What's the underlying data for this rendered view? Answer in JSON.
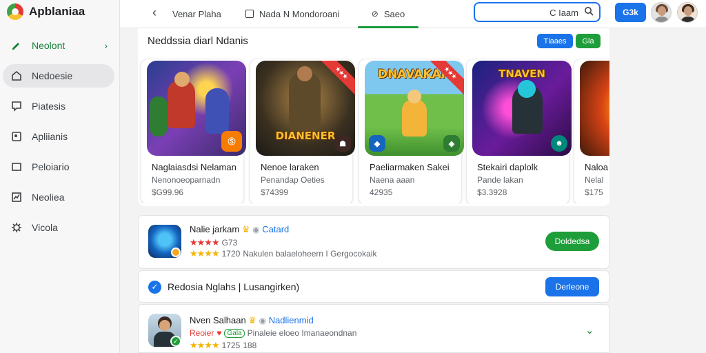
{
  "app": {
    "title": "Apblaniaa"
  },
  "sidebar": {
    "items": [
      {
        "label": "Neolont",
        "icon": "edit-pencil-icon"
      },
      {
        "label": "Nedoesie",
        "icon": "home-icon"
      },
      {
        "label": "Piatesis",
        "icon": "message-icon"
      },
      {
        "label": "Apliianis",
        "icon": "apps-icon"
      },
      {
        "label": "Peloiario",
        "icon": "tv-icon"
      },
      {
        "label": "Neoliea",
        "icon": "chart-icon"
      },
      {
        "label": "Vicola",
        "icon": "settings-icon"
      }
    ]
  },
  "topbar": {
    "tabs": [
      {
        "label": "Venar Plaha"
      },
      {
        "label": "Nada N Mondoroani"
      },
      {
        "label": "Saeo"
      }
    ],
    "search": {
      "value": "C Iaam",
      "placeholder": ""
    },
    "button_label": "G3k"
  },
  "section": {
    "title": "Neddssia diarl Ndanis",
    "pill_blue": "Tlaaes",
    "pill_green": "Gla"
  },
  "cards": [
    {
      "name": "Naglaiasdsi Nelaman",
      "developer": "Nenonoeoparnadn",
      "price": "$G99.96"
    },
    {
      "name": "Nenoe laraken",
      "developer": "Penandap Oeties",
      "price": "$74399",
      "art_title": "DIANENER"
    },
    {
      "name": "Paeliarmaken Sakei",
      "developer": "Naena aaan",
      "price": "42935",
      "art_title": "DNAVAKAN"
    },
    {
      "name": "Stekairi daplolk",
      "developer": "Pande lakan",
      "price": "$3.3928",
      "art_title": "TNAVEN"
    },
    {
      "name": "Naloa",
      "developer": "Nelal",
      "price": "$175"
    }
  ],
  "rows": [
    {
      "name": "Nalie jarkam",
      "category": "Catard",
      "rating_text": "G73",
      "size": "1720",
      "meta_text": "Nakulen balaeloheern I Gergocokaik",
      "button": "Doldedsa"
    },
    {
      "title": "Redosia Nglahs | Lusangirken)",
      "button": "Derleone"
    },
    {
      "name": "Nven Salhaan",
      "category": "Nadlienmid",
      "badge": "Reoier",
      "badge2": "Gala",
      "meta_text": "Pinaleie eloeo Imanaeondnan",
      "size": "1725",
      "count": "188"
    }
  ],
  "colors": {
    "accent_green": "#1e9e3a",
    "accent_blue": "#1a73e8",
    "star": "#f4b400"
  }
}
